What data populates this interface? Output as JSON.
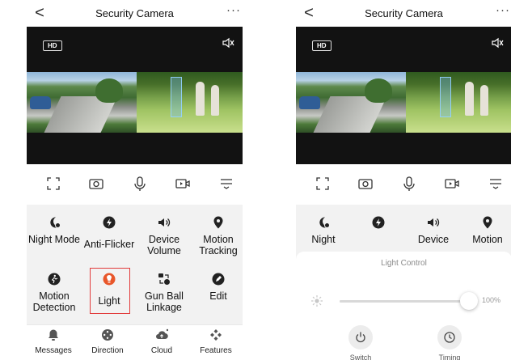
{
  "app": {
    "title": "Security Camera",
    "back_glyph": "<",
    "more_glyph": "···"
  },
  "video": {
    "badge": "HD",
    "icons": [
      "mute-icon"
    ]
  },
  "toolbar": {
    "icons": [
      "fullscreen-icon",
      "snapshot-icon",
      "microphone-icon",
      "record-icon",
      "menu-icon"
    ]
  },
  "features": [
    {
      "label": "Night Mode",
      "icon": "night-mode-icon"
    },
    {
      "label": "Anti-Flicker",
      "icon": "anti-flicker-icon"
    },
    {
      "label": "Device Volume",
      "icon": "volume-icon"
    },
    {
      "label": "Motion Tracking",
      "icon": "location-pin-icon"
    },
    {
      "label": "Motion Detection",
      "icon": "running-person-icon"
    },
    {
      "label": "Light",
      "icon": "light-icon",
      "selected": true
    },
    {
      "label": "Gun Ball Linkage",
      "icon": "linkage-icon"
    },
    {
      "label": "Edit",
      "icon": "edit-icon"
    }
  ],
  "features_partial": [
    "Night",
    "Device",
    "Motion"
  ],
  "tabbar": [
    {
      "label": "Messages",
      "icon": "bell-icon"
    },
    {
      "label": "Direction",
      "icon": "direction-pad-icon"
    },
    {
      "label": "Cloud",
      "icon": "cloud-icon"
    },
    {
      "label": "Features",
      "icon": "features-grid-icon"
    }
  ],
  "light_control": {
    "title": "Light Control",
    "brightness_percent": 100,
    "brightness_label": "100%",
    "switch_label": "Switch",
    "timing_label": "Timing"
  },
  "colors": {
    "video_bg": "#121212",
    "panel_bg": "#f2f2f2",
    "highlight": "#e23a3a",
    "light_icon": "#e8562a",
    "icon_dark": "#222222"
  }
}
